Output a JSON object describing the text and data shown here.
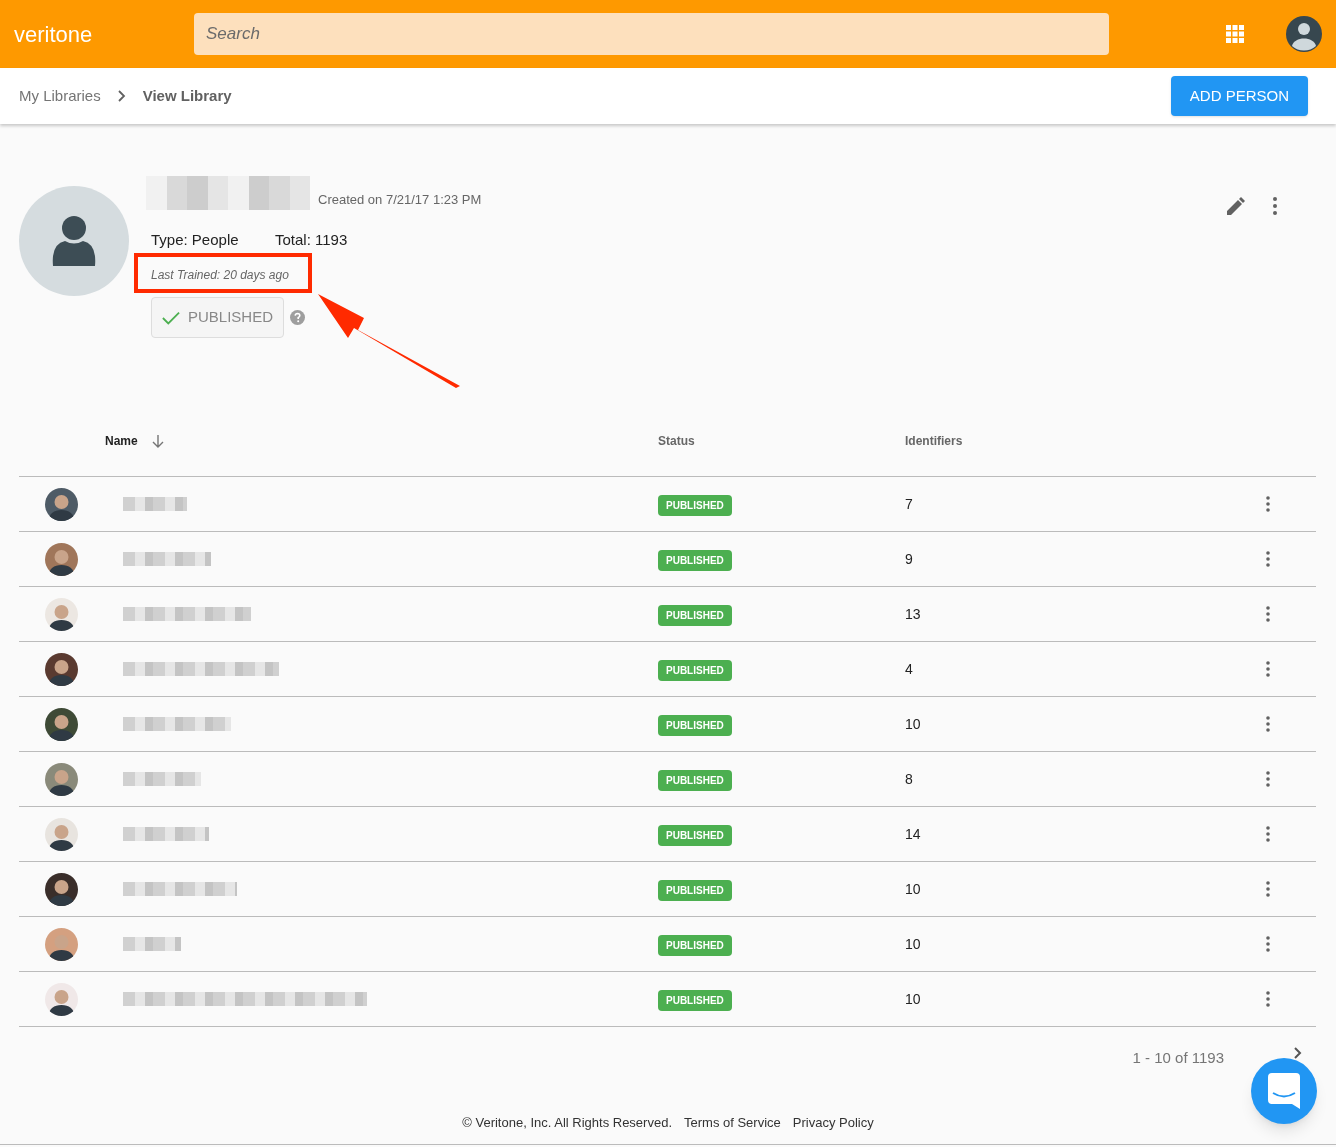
{
  "header": {
    "logo": "veritone",
    "search": {
      "placeholder": "Search"
    }
  },
  "breadcrumb": [
    {
      "label": "My Libraries",
      "current": false
    },
    {
      "label": "View Library",
      "current": true
    }
  ],
  "add_button": "ADD PERSON",
  "library": {
    "created": "Created on 7/21/17 1:23 PM",
    "type": "Type: People",
    "total": "Total: 1193",
    "last_trained": "Last Trained: 20 days ago",
    "published_button": "PUBLISHED",
    "highlighted": true
  },
  "table": {
    "columns": [
      "Name",
      "Status",
      "Identifiers"
    ],
    "rows": [
      {
        "status": "PUBLISHED",
        "identifiers": "7"
      },
      {
        "status": "PUBLISHED",
        "identifiers": "9"
      },
      {
        "status": "PUBLISHED",
        "identifiers": "13"
      },
      {
        "status": "PUBLISHED",
        "identifiers": "4"
      },
      {
        "status": "PUBLISHED",
        "identifiers": "10"
      },
      {
        "status": "PUBLISHED",
        "identifiers": "8"
      },
      {
        "status": "PUBLISHED",
        "identifiers": "14"
      },
      {
        "status": "PUBLISHED",
        "identifiers": "10"
      },
      {
        "status": "PUBLISHED",
        "identifiers": "10"
      },
      {
        "status": "PUBLISHED",
        "identifiers": "10"
      }
    ]
  },
  "pagination": "1 - 10 of 1193",
  "footer": [
    "© Veritone, Inc. All Rights Reserved.",
    "Terms of Service",
    "Privacy Policy"
  ]
}
